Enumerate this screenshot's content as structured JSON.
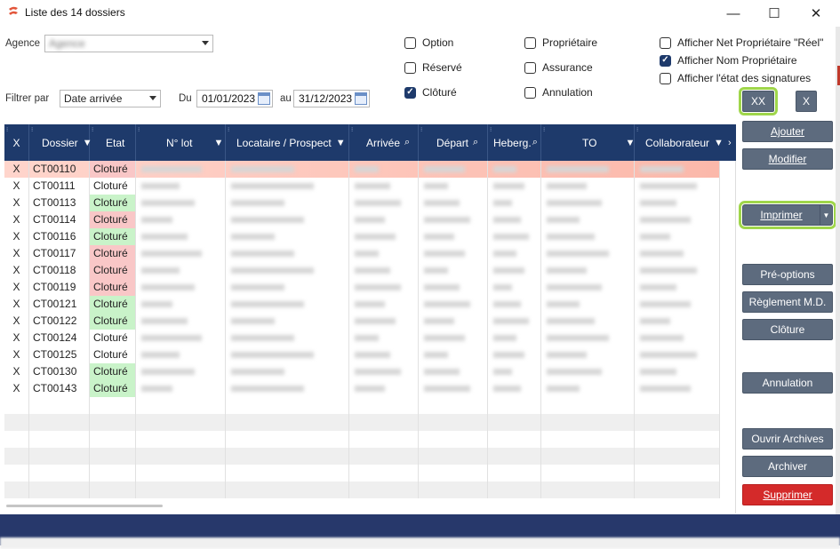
{
  "window": {
    "title": "Liste des 14 dossiers",
    "minimize_icon": "—",
    "maximize_icon": "☐",
    "close_icon": "✕"
  },
  "filters": {
    "agence_label": "Agence",
    "agence_value": "Agence",
    "filtrer_par_label": "Filtrer par",
    "filtrer_par_value": "Date arrivée",
    "du_label": "Du",
    "du_value": "01/01/2023",
    "au_label": "au",
    "au_value": "31/12/2023",
    "checkboxes": [
      {
        "label": "Option",
        "checked": false
      },
      {
        "label": "Réservé",
        "checked": false
      },
      {
        "label": "Clôturé",
        "checked": true
      },
      {
        "label": "Propriétaire",
        "checked": false
      },
      {
        "label": "Assurance",
        "checked": false
      },
      {
        "label": "Annulation",
        "checked": false
      },
      {
        "label": "Afficher Net Propriétaire \"Réel\"",
        "checked": false
      },
      {
        "label": "Afficher Nom Propriétaire",
        "checked": true
      },
      {
        "label": "Afficher l'état des signatures",
        "checked": false
      }
    ]
  },
  "grid": {
    "columns": [
      "X",
      "Dossier",
      "Etat",
      "N° lot",
      "Locataire / Prospect",
      "Arrivée",
      "Départ",
      "Heberg.",
      "TO",
      "Collaborateur"
    ],
    "rows": [
      {
        "x": "X",
        "dossier": "CT00110",
        "etat": "Cloturé",
        "color": "red"
      },
      {
        "x": "X",
        "dossier": "CT00111",
        "etat": "Cloturé",
        "color": "white"
      },
      {
        "x": "X",
        "dossier": "CT00113",
        "etat": "Cloturé",
        "color": "green"
      },
      {
        "x": "X",
        "dossier": "CT00114",
        "etat": "Cloturé",
        "color": "red"
      },
      {
        "x": "X",
        "dossier": "CT00116",
        "etat": "Cloturé",
        "color": "green"
      },
      {
        "x": "X",
        "dossier": "CT00117",
        "etat": "Cloturé",
        "color": "red"
      },
      {
        "x": "X",
        "dossier": "CT00118",
        "etat": "Cloturé",
        "color": "red"
      },
      {
        "x": "X",
        "dossier": "CT00119",
        "etat": "Cloturé",
        "color": "red"
      },
      {
        "x": "X",
        "dossier": "CT00121",
        "etat": "Cloturé",
        "color": "green"
      },
      {
        "x": "X",
        "dossier": "CT00122",
        "etat": "Cloturé",
        "color": "green"
      },
      {
        "x": "X",
        "dossier": "CT00124",
        "etat": "Cloturé",
        "color": "white"
      },
      {
        "x": "X",
        "dossier": "CT00125",
        "etat": "Cloturé",
        "color": "white"
      },
      {
        "x": "X",
        "dossier": "CT00130",
        "etat": "Cloturé",
        "color": "green"
      },
      {
        "x": "X",
        "dossier": "CT00143",
        "etat": "Cloturé",
        "color": "green"
      }
    ]
  },
  "sidebar": {
    "xx_label": "XX",
    "x_label": "X",
    "ajouter": "Ajouter",
    "modifier": "Modifier",
    "imprimer": "Imprimer",
    "pre_options": "Pré-options",
    "reglement": "Règlement M.D.",
    "cloture": "Clôture",
    "annulation": "Annulation",
    "ouvrir_archives": "Ouvrir Archives",
    "archiver": "Archiver",
    "supprimer": "Supprimer"
  },
  "colors": {
    "header_bg": "#1e3a6b",
    "button_bg": "#5d6b7e",
    "delete_bg": "#d42a2a",
    "highlight": "#9fd64a",
    "etat_red": "#f9c7c7",
    "etat_green": "#c9f3c9"
  }
}
